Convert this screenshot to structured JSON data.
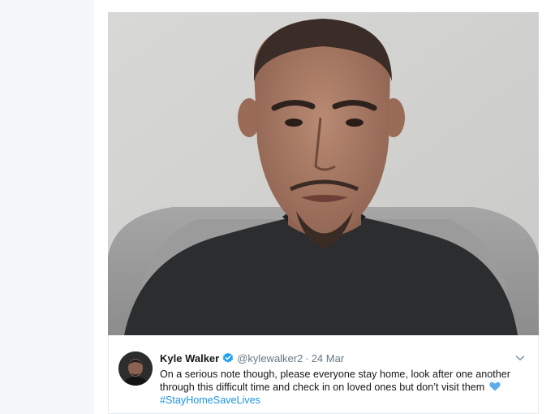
{
  "tweet": {
    "display_name": "Kyle Walker",
    "handle": "@kylewalker2",
    "separator": "·",
    "timestamp": "24 Mar",
    "text": "On a serious note though, please everyone stay home, look after one another through this difficult time and check in on loved ones but don’t visit them",
    "hashtag": "#StayHomeSaveLives",
    "verified_icon": "verified-badge-icon",
    "heart_icon": "blue-heart-icon",
    "menu_icon": "chevron-down-icon"
  },
  "colors": {
    "link": "#1b95e0",
    "verified": "#1da1f2",
    "secondary_text": "#657786",
    "primary_text": "#14171a"
  }
}
